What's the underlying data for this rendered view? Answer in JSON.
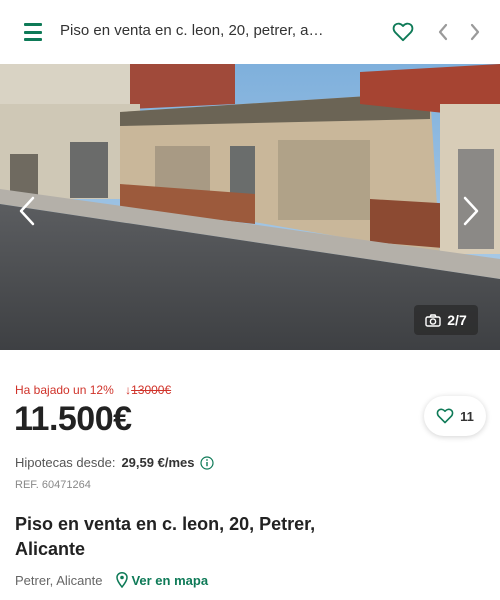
{
  "header": {
    "title": "Piso en venta en c. leon, 20, petrer, alica...",
    "icons": [
      "menu-icon",
      "heart-icon",
      "chevron-left-icon",
      "chevron-right-icon"
    ],
    "accent_color": "#0e7a57"
  },
  "gallery": {
    "counter": "2/7",
    "icons": [
      "camera-icon",
      "chevron-left-icon",
      "chevron-right-icon"
    ]
  },
  "listing": {
    "price_drop": "Ha bajado un 12%",
    "old_price_arrow": "↓",
    "old_price": "13000€",
    "price": "11.500€",
    "likes": "11",
    "mortgage_label": "Hipotecas desde:",
    "mortgage_value": "29,59 €/mes",
    "reference": "REF. 60471264",
    "title": "Piso en venta en c. leon, 20, Petrer, Alicante",
    "location": "Petrer, Alicante",
    "map_link": "Ver en mapa",
    "drop_color": "#d0332a"
  }
}
